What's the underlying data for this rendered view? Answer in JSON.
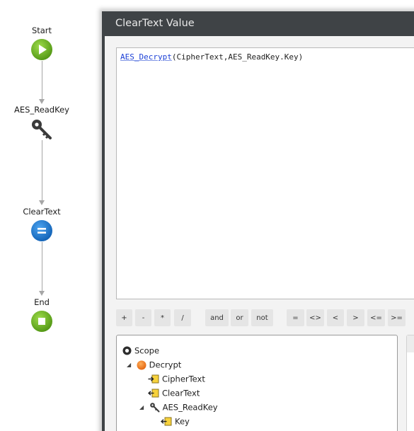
{
  "flow": {
    "nodes": [
      {
        "label": "Start",
        "icon": "start-icon"
      },
      {
        "label": "AES_ReadKey",
        "icon": "key-icon"
      },
      {
        "label": "ClearText",
        "icon": "assign-icon"
      },
      {
        "label": "End",
        "icon": "end-icon"
      }
    ]
  },
  "dialog": {
    "title": "ClearText Value",
    "expression": {
      "func": "AES_Decrypt",
      "rest": "(CipherText,AES_ReadKey.Key)"
    },
    "operators": [
      "+",
      "-",
      "*",
      "/",
      "and",
      "or",
      "not",
      "=",
      "<>",
      "<",
      ">",
      "<=",
      ">="
    ],
    "scope": {
      "root": "Scope",
      "items": [
        {
          "label": "Decrypt",
          "icon": "action-icon"
        },
        {
          "label": "CipherText",
          "icon": "input-parameter-icon"
        },
        {
          "label": "ClearText",
          "icon": "output-parameter-icon"
        },
        {
          "label": "AES_ReadKey",
          "icon": "key-icon"
        },
        {
          "label": "Key",
          "icon": "output-parameter-icon"
        }
      ]
    }
  },
  "colors": {
    "header": "#3f4346",
    "start": "#6cb21f",
    "assign": "#1d78cf",
    "function_token": "#1a3fd6",
    "action": "#f07c1c"
  }
}
